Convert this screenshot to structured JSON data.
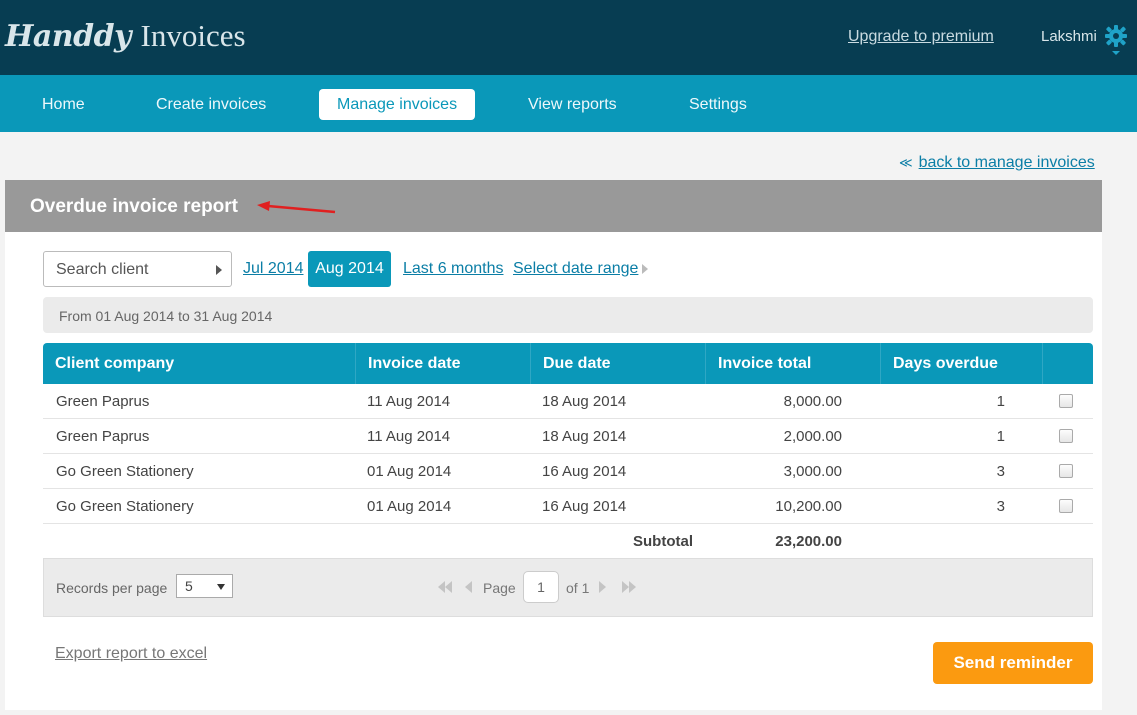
{
  "app": {
    "logo_script": "Handdy",
    "logo_plain": "Invoices",
    "upgrade_link": "Upgrade to premium",
    "user_name": "Lakshmi"
  },
  "nav": {
    "items": [
      {
        "label": "Home"
      },
      {
        "label": "Create invoices"
      },
      {
        "label": "Manage invoices",
        "active": true
      },
      {
        "label": "View reports"
      },
      {
        "label": "Settings"
      }
    ]
  },
  "back_link": {
    "chevron": "≪",
    "label": "back to manage invoices"
  },
  "report": {
    "title": "Overdue invoice report"
  },
  "filters": {
    "search_label": "Search client",
    "options": [
      {
        "label": "Jul 2014"
      },
      {
        "label": "Aug 2014",
        "active": true
      },
      {
        "label": "Last 6 months"
      },
      {
        "label": "Select date range"
      }
    ],
    "range_text": "From 01 Aug 2014 to 31 Aug 2014"
  },
  "table": {
    "columns": [
      "Client company",
      "Invoice date",
      "Due date",
      "Invoice total",
      "Days overdue"
    ],
    "rows": [
      {
        "client": "Green Paprus",
        "invoice_date": "11 Aug 2014",
        "due_date": "18 Aug 2014",
        "total": "8,000.00",
        "days": "1"
      },
      {
        "client": "Green Paprus",
        "invoice_date": "11 Aug 2014",
        "due_date": "18 Aug 2014",
        "total": "2,000.00",
        "days": "1"
      },
      {
        "client": "Go Green Stationery",
        "invoice_date": "01 Aug 2014",
        "due_date": "16 Aug 2014",
        "total": "3,000.00",
        "days": "3"
      },
      {
        "client": "Go Green Stationery",
        "invoice_date": "01 Aug 2014",
        "due_date": "16 Aug 2014",
        "total": "10,200.00",
        "days": "3"
      }
    ],
    "subtotal_label": "Subtotal",
    "subtotal_value": "23,200.00"
  },
  "pagination": {
    "records_label": "Records per page",
    "records_value": "5",
    "page_label": "Page",
    "page_value": "1",
    "of_label": "of 1"
  },
  "actions": {
    "export_label": "Export report to excel",
    "send_label": "Send reminder"
  },
  "colors": {
    "topbar": "#073d52",
    "nav": "#0a98b9",
    "accent": "#fb9a10",
    "link": "#0b7ea6",
    "annotation_arrow": "#e02020"
  },
  "icons": {
    "settings": "gear-icon",
    "back": "double-chevron-left-icon",
    "annotation": "red-arrow-icon"
  }
}
